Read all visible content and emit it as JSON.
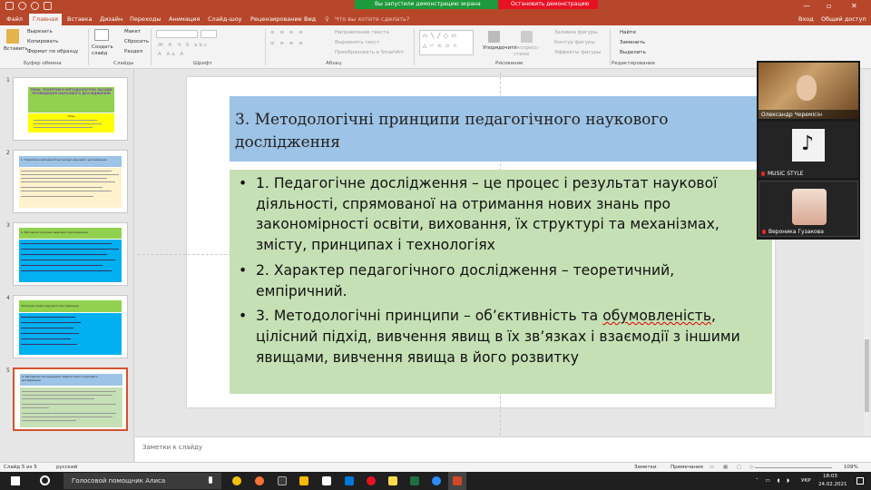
{
  "titlebar": {
    "share_notice": "Вы запустили демонстрацию экрана",
    "stop_label": "Остановить демонстрацию",
    "minimize": "—",
    "maximize": "▫",
    "close": "✕"
  },
  "tabs": [
    "Файл",
    "Главная",
    "Вставка",
    "Дизайн",
    "Переходы",
    "Анимация",
    "Слайд-шоу",
    "Рецензирование",
    "Вид"
  ],
  "tell_me": "Что вы хотите сделать?",
  "signin": "Вход",
  "share": "Общий доступ",
  "ribbon": {
    "clipboard": {
      "paste": "Вставить",
      "cut": "Вырезать",
      "copy": "Копировать",
      "format_painter": "Формат по образцу",
      "group": "Буфер обмена"
    },
    "slides": {
      "new_slide": "Создать слайд",
      "layout": "Макет",
      "reset": "Сбросить",
      "section": "Раздел",
      "group": "Слайды"
    },
    "font": {
      "group": "Шрифт"
    },
    "paragraph": {
      "text_direction": "Направление текста",
      "align_text": "Выровнять текст",
      "smartart": "Преобразовать в SmartArt",
      "group": "Абзац"
    },
    "drawing": {
      "arrange": "Упорядочить",
      "quick_styles": "Экспресс-стили",
      "shape_fill": "Заливка фигуры",
      "shape_outline": "Контур фигуры",
      "shape_effects": "Эффекты фигуры",
      "group": "Рисование"
    },
    "editing": {
      "find": "Найти",
      "replace": "Заменить",
      "select": "Выделить",
      "group": "Редактирование"
    }
  },
  "thumbnails": [
    {
      "num": "1",
      "title": "ТЕМА: ТЕОРЕТИКО-МЕТОДОЛОГІЧНІ ЗАСАДИ ПРОВЕДЕННЯ НАУКОВОГО ДОСЛІДЖЕННЯ",
      "sub": "План"
    },
    {
      "num": "2",
      "title": "1. Теоретико-методологічні засади наукового дослідження"
    },
    {
      "num": "3",
      "title": "2. Методологічні рівні наукового дослідження"
    },
    {
      "num": "4",
      "title": "Загальна схема наукового дослідження"
    },
    {
      "num": "5",
      "title": "3. Методологічні принципи педагогічного наукового дослідження"
    }
  ],
  "slide": {
    "title": "3. Методологічні принципи педагогічного наукового дослідження",
    "bullets": [
      "1. Педагогічне дослідження – це процес і результат наукової діяльності, спрямованої на отримання нових знань про закономірності освіти, виховання, їх структурі та механізмах, змісту, принципах і технологіях",
      "2. Характер педагогічного дослідження – теоретичний, емпіричний."
    ],
    "bullet3_a": "3. Методологічні принципи – об’єктивність та ",
    "bullet3_spell": "обумовленість",
    "bullet3_b": ", цілісний підхід, вивчення явищ в їх зв’язках і взаємодії з іншими явищами, вивчення явища в його розвитку"
  },
  "notes_placeholder": "Заметки к слайду",
  "video": [
    {
      "name": "Олександр Черемісін",
      "muted": false
    },
    {
      "name": "MUSIC STYLE",
      "muted": true
    },
    {
      "name": "Вероника Гузакова",
      "muted": true
    }
  ],
  "status": {
    "slide_count": "Слайд 5 из 5",
    "language": "русский",
    "notes": "Заметки",
    "comments": "Примечания",
    "zoom": "109%"
  },
  "taskbar": {
    "search": "Голосовой помощник Алиса",
    "lang": "УКР",
    "time": "18:03",
    "date": "24.02.2021"
  }
}
